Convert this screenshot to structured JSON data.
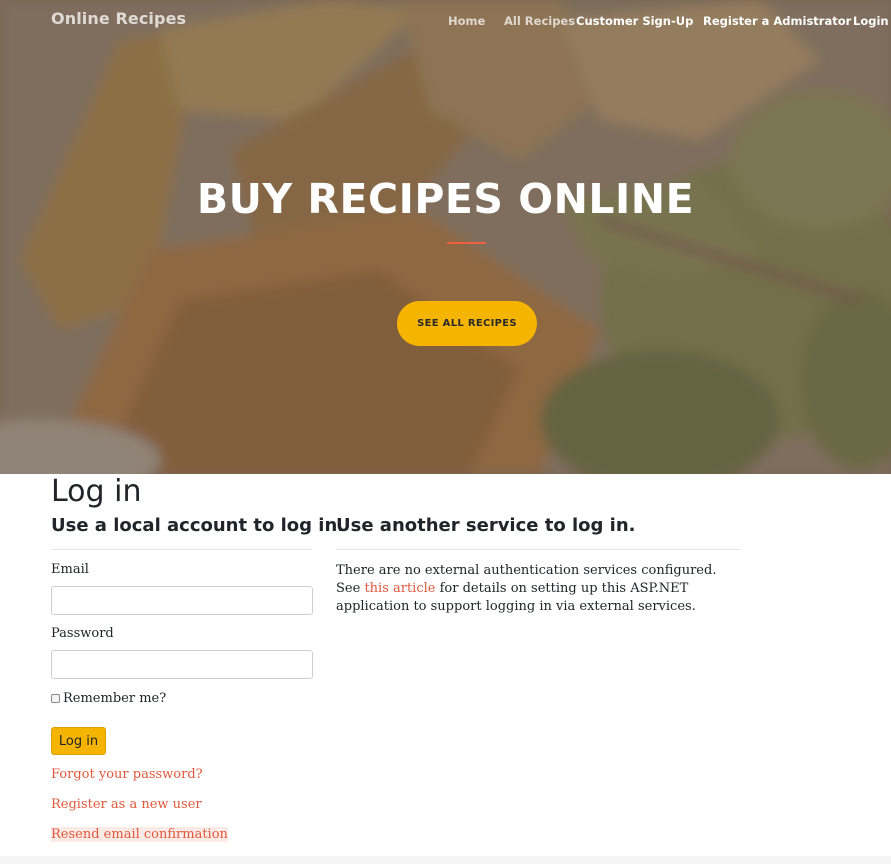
{
  "nav": {
    "brand": "Online Recipes",
    "items": [
      {
        "label": "Home",
        "active": false
      },
      {
        "label": "All Recipes",
        "active": false
      },
      {
        "label": "Customer Sign-Up",
        "active": true
      },
      {
        "label": "Register a Admistrator",
        "active": true
      },
      {
        "label": "Login",
        "active": true
      }
    ]
  },
  "hero": {
    "title": "BUY RECIPES ONLINE",
    "button": "SEE ALL RECIPES",
    "accent_color": "#f05f40",
    "button_color": "#f4b400"
  },
  "login": {
    "title": "Log in",
    "local_heading": "Use a local account to log in.",
    "email_label": "Email",
    "email_value": "",
    "password_label": "Password",
    "password_value": "",
    "remember_label": "Remember me?",
    "remember_checked": false,
    "submit": "Log in",
    "links": {
      "forgot": "Forgot your password?",
      "register": "Register as a new user",
      "resend": "Resend email confirmation"
    }
  },
  "external": {
    "heading": "Use another service to log in.",
    "text_before": "There are no external authentication services configured. See ",
    "link_text": "this article",
    "text_after": " for details on setting up this ASP.NET application to support logging in via external services."
  },
  "colors": {
    "link": "#e0583b",
    "primary_button": "#f4b400"
  },
  "icons": {
    "checkbox": "checkbox-unchecked"
  }
}
